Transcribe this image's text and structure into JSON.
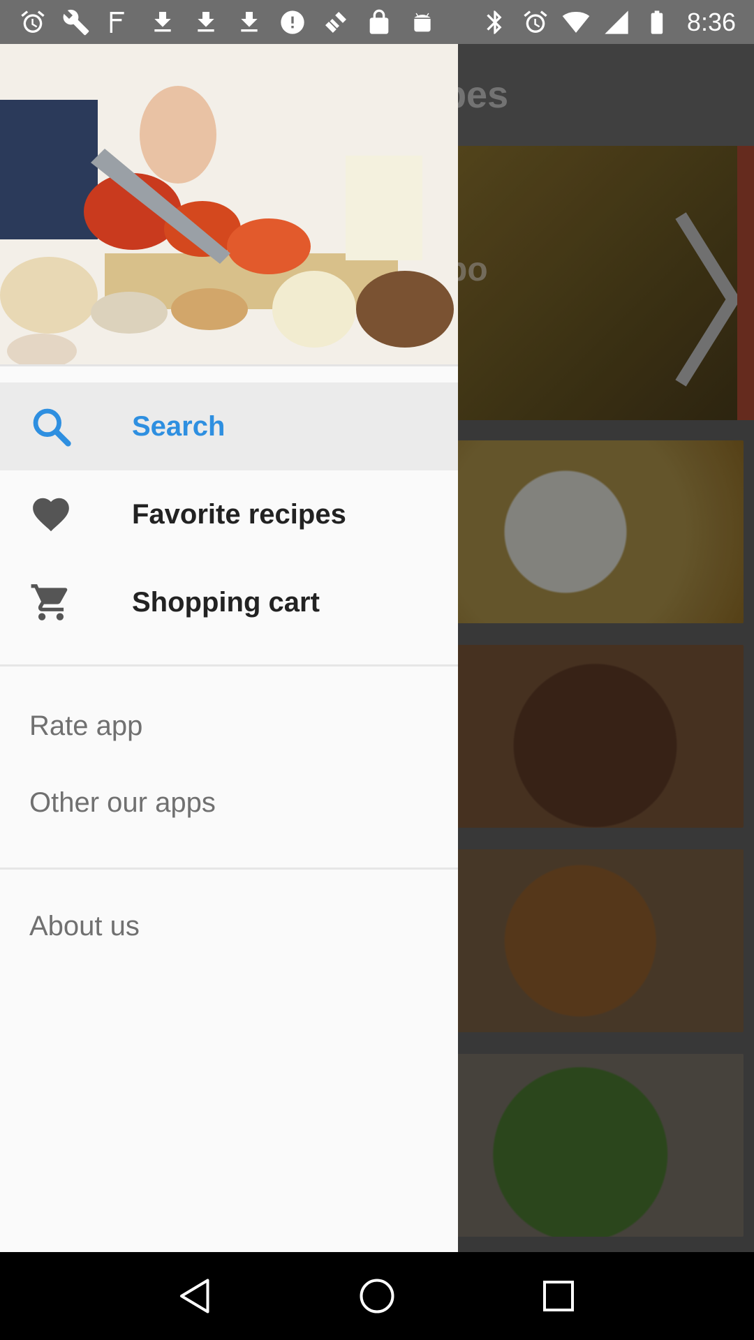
{
  "status_bar": {
    "time": "8:36",
    "left_icons": [
      "alarm-icon",
      "wrench-icon",
      "newspaper-icon",
      "download-icon",
      "download-icon",
      "download-icon",
      "blocked-icon",
      "satellite-icon",
      "lock-icon",
      "android-icon"
    ],
    "right_icons": [
      "bluetooth-icon",
      "alarm-icon",
      "wifi-icon",
      "signal-icon",
      "battery-icon"
    ]
  },
  "background_app": {
    "title": "ecipes",
    "hero_text": "bo"
  },
  "drawer": {
    "menu": [
      {
        "label": "Search",
        "icon": "search-icon",
        "active": true
      },
      {
        "label": "Favorite recipes",
        "icon": "heart-icon",
        "active": false
      },
      {
        "label": "Shopping cart",
        "icon": "cart-icon",
        "active": false
      }
    ],
    "secondary": [
      {
        "label": "Rate app"
      },
      {
        "label": "Other our apps"
      }
    ],
    "tertiary": [
      {
        "label": "About us"
      }
    ]
  },
  "colors": {
    "accent": "#2e8fe0",
    "drawer_bg": "#fafafa",
    "active_bg": "#ebebeb",
    "status_bar": "#6e6e6e"
  },
  "nav_bar": {
    "buttons": [
      "back-icon",
      "home-icon",
      "recents-icon"
    ]
  }
}
